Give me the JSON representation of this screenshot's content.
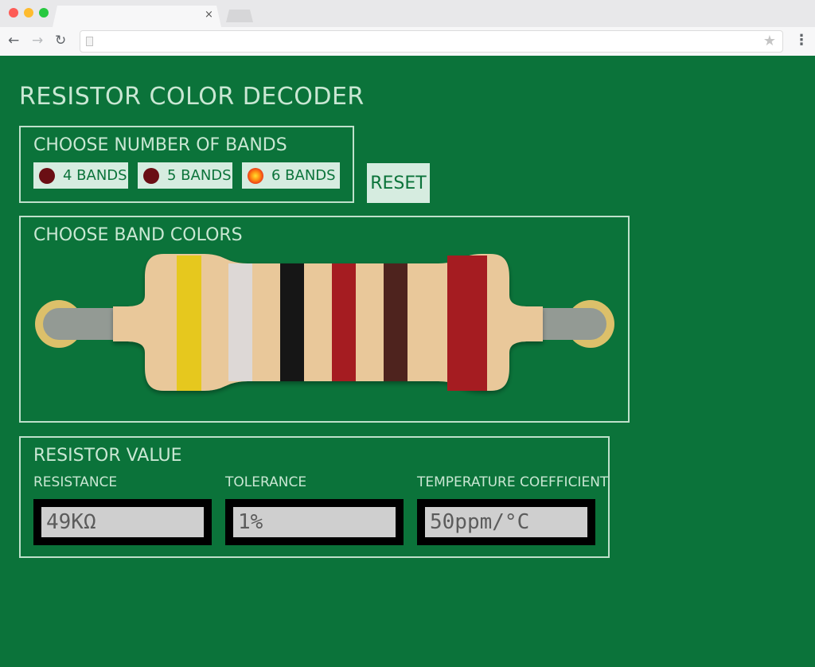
{
  "browser": {
    "tab_close_glyph": "×",
    "back_glyph": "←",
    "forward_glyph": "→",
    "reload_glyph": "↻",
    "star_glyph": "★",
    "menu_glyph": "⋮",
    "address": ""
  },
  "app": {
    "title": "RESISTOR COLOR DECODER",
    "background_color": "#0b733a"
  },
  "bands_section": {
    "title": "CHOOSE NUMBER OF BANDS",
    "options": [
      {
        "label": "4 BANDS",
        "selected": false
      },
      {
        "label": "5 BANDS",
        "selected": false
      },
      {
        "label": "6 BANDS",
        "selected": true
      }
    ]
  },
  "reset_label": "RESET",
  "colors_section": {
    "title": "CHOOSE BAND COLORS",
    "body_color": "#e9c89a",
    "bands": [
      {
        "color": "yellow",
        "hex": "#e6c81e"
      },
      {
        "color": "white",
        "hex": "#ddd8d6"
      },
      {
        "color": "black",
        "hex": "#161616"
      },
      {
        "color": "red",
        "hex": "#a51c21"
      },
      {
        "color": "brown",
        "hex": "#4e231e"
      },
      {
        "color": "red",
        "hex": "#a51c21"
      }
    ]
  },
  "value_section": {
    "title": "RESISTOR VALUE",
    "resistance": {
      "label": "RESISTANCE",
      "value": "49KΩ"
    },
    "tolerance": {
      "label": "TOLERANCE",
      "value": "1%"
    },
    "temp_coeff": {
      "label": "TEMPERATURE COEFFICIENT",
      "value": "50ppm/°C"
    }
  }
}
